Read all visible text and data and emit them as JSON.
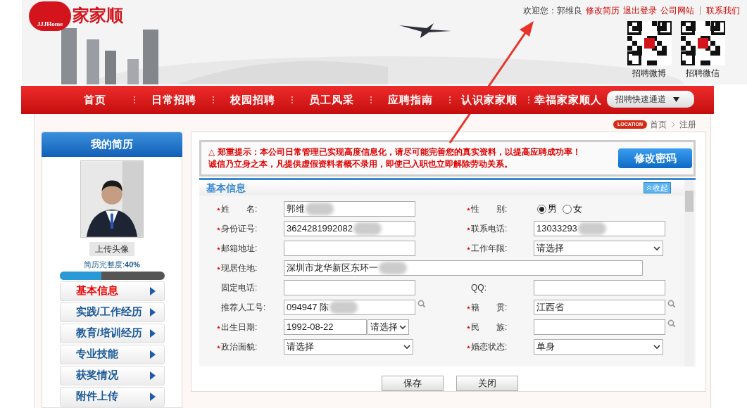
{
  "header": {
    "logo_badge": "JJJHome",
    "logo_text": "家家顺",
    "welcome": "欢迎您：",
    "user": "郭维良",
    "links": [
      "修改简历",
      "退出登录",
      "公司网站",
      "联系我们"
    ],
    "qr_codes": [
      {
        "label": "招聘微博"
      },
      {
        "label": "招聘微信"
      }
    ]
  },
  "nav": {
    "items": [
      "首页",
      "日常招聘",
      "校园招聘",
      "员工风采",
      "应聘指南",
      "认识家家顺",
      "幸福家家顺人"
    ],
    "quick_select": "招聘快速通道"
  },
  "breadcrumb": {
    "badge": "LOCATION",
    "items": [
      "首页",
      "注册"
    ]
  },
  "sidebar": {
    "title": "我的简历",
    "upload_button": "上传头像",
    "completeness_label": "简历完整度:",
    "completeness_value": "40%",
    "level": 0.4,
    "items": [
      {
        "label": "基本信息",
        "selected": true
      },
      {
        "label": "实践/工作经历",
        "selected": false
      },
      {
        "label": "教育/培训经历",
        "selected": false
      },
      {
        "label": "专业技能",
        "selected": false
      },
      {
        "label": "获奖情况",
        "selected": false
      },
      {
        "label": "附件上传",
        "selected": false
      }
    ]
  },
  "notice": {
    "lines": [
      "△ 郑重提示：本公司日常管理已实现高度信息化，请尽可能完善您的真实资料，以提高应聘成功率！",
      "诚信乃立身之本，凡提供虚假资料者概不录用，即使已入职也立即解除劳动关系。"
    ],
    "button": "修改密码"
  },
  "section": {
    "title": "基本信息",
    "collapse_button": "收起",
    "rows": [
      [
        {
          "kind": "text",
          "label": "姓　　名:",
          "required": true,
          "value": "郭维",
          "redacted": true
        },
        {
          "kind": "radio",
          "label": "性　　别:",
          "required": true,
          "options": [
            {
              "label": "男",
              "selected": true
            },
            {
              "label": "女",
              "selected": false
            }
          ]
        }
      ],
      [
        {
          "kind": "text",
          "label": "身份证号:",
          "required": true,
          "value": "3624281992082",
          "redacted": true
        },
        {
          "kind": "text",
          "label": "联系电话:",
          "required": true,
          "value": "13033293",
          "redacted": true
        }
      ],
      [
        {
          "kind": "text",
          "label": "邮箱地址:",
          "required": true
        },
        {
          "kind": "select",
          "label": "工作年限:",
          "required": true,
          "value": "请选择"
        }
      ],
      [
        {
          "kind": "wide",
          "label": "现居住地:",
          "required": true,
          "value": "深圳市龙华新区东环一",
          "redacted": true
        }
      ],
      [
        {
          "kind": "text",
          "label": "固定电话:",
          "required": false
        },
        {
          "kind": "text",
          "label": "QQ:",
          "required": false
        }
      ],
      [
        {
          "kind": "text",
          "label": "推荐人工号:",
          "required": false,
          "value": "094947 陈",
          "redacted": true,
          "search": true
        },
        {
          "kind": "text",
          "label": "籍　　贯:",
          "required": true,
          "value": "江西省",
          "search": true
        }
      ],
      [
        {
          "kind": "date",
          "label": "出生日期:",
          "required": true,
          "value": "1992-08-22",
          "select_value": "请选择"
        },
        {
          "kind": "text",
          "label": "民　　族:",
          "required": true,
          "search": true
        }
      ],
      [
        {
          "kind": "select",
          "label": "政治面貌:",
          "required": true,
          "value": "请选择"
        },
        {
          "kind": "select",
          "label": "婚恋状态:",
          "required": true,
          "value": "单身"
        }
      ]
    ]
  },
  "buttons": [
    "保存",
    "关闭"
  ]
}
